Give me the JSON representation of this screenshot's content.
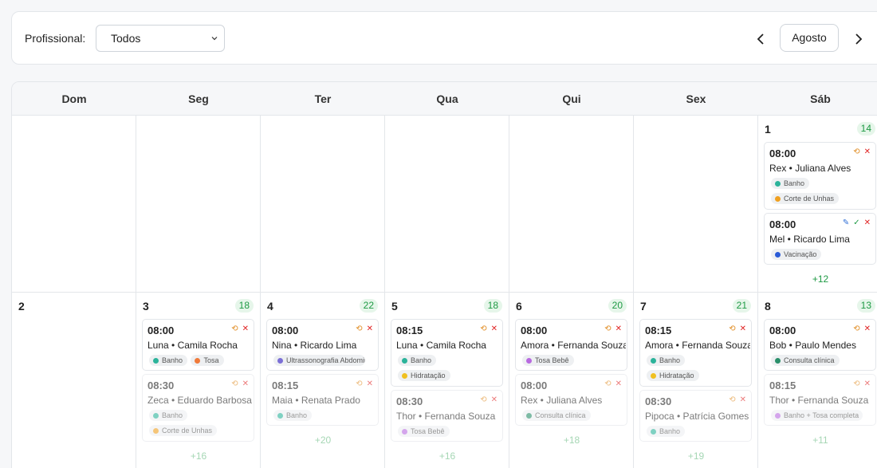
{
  "filter": {
    "label": "Profissional:",
    "selected": "Todos",
    "prev_icon": "chevron-left-icon",
    "next_icon": "chevron-right-icon",
    "month": "Agosto"
  },
  "weekdays": [
    "Dom",
    "Seg",
    "Ter",
    "Qua",
    "Qui",
    "Sex",
    "Sáb"
  ],
  "colors": {
    "banho": "#2bb39a",
    "tosa": "#f07a3a",
    "corte_unhas": "#f0a020",
    "vacinacao": "#2a5bd7",
    "ultrassonografia": "#7b6fd6",
    "hidratacao": "#f0c020",
    "tosa_bebe": "#b86ae0",
    "consulta": "#2a8f6a",
    "accent_green": "#1e9a44"
  },
  "days": {
    "d1": {
      "num": "1",
      "count": "14",
      "more": "+12",
      "appts": [
        {
          "time": "08:00",
          "who": "Rex • Juliana Alves",
          "tags": [
            "Banho",
            "Corte de Unhas"
          ]
        },
        {
          "time": "08:00",
          "who": "Mel • Ricardo Lima",
          "tags": [
            "Vacinação"
          ]
        }
      ]
    },
    "d2": {
      "num": "2"
    },
    "d3": {
      "num": "3",
      "count": "18",
      "more": "+16",
      "appts": [
        {
          "time": "08:00",
          "who": "Luna • Camila Rocha",
          "tags": [
            "Banho",
            "Tosa"
          ]
        },
        {
          "time": "08:30",
          "who": "Zeca • Eduardo Barbosa",
          "tags": [
            "Banho",
            "Corte de Unhas"
          ]
        }
      ]
    },
    "d4": {
      "num": "4",
      "count": "22",
      "more": "+20",
      "appts": [
        {
          "time": "08:00",
          "who": "Nina • Ricardo Lima",
          "tags": [
            "Ultrassonografia Abdominal"
          ]
        },
        {
          "time": "08:15",
          "who": "Maia • Renata Prado",
          "tags": [
            "Banho"
          ]
        }
      ]
    },
    "d5": {
      "num": "5",
      "count": "18",
      "more": "+16",
      "appts": [
        {
          "time": "08:15",
          "who": "Luna • Camila Rocha",
          "tags": [
            "Banho",
            "Hidratação"
          ]
        },
        {
          "time": "08:30",
          "who": "Thor • Fernanda Souza",
          "tags": [
            "Tosa Bebê"
          ]
        }
      ]
    },
    "d6": {
      "num": "6",
      "count": "20",
      "more": "+18",
      "appts": [
        {
          "time": "08:00",
          "who": "Amora • Fernanda Souza",
          "tags": [
            "Tosa Bebê"
          ]
        },
        {
          "time": "08:00",
          "who": "Rex • Juliana Alves",
          "tags": [
            "Consulta clínica"
          ]
        }
      ]
    },
    "d7": {
      "num": "7",
      "count": "21",
      "more": "+19",
      "appts": [
        {
          "time": "08:15",
          "who": "Amora • Fernanda Souza",
          "tags": [
            "Banho",
            "Hidratação"
          ]
        },
        {
          "time": "08:30",
          "who": "Pipoca • Patrícia Gomes",
          "tags": [
            "Banho"
          ]
        }
      ]
    },
    "d8": {
      "num": "8",
      "count": "13",
      "more": "+11",
      "appts": [
        {
          "time": "08:00",
          "who": "Bob • Paulo Mendes",
          "tags": [
            "Consulta clínica"
          ]
        },
        {
          "time": "08:15",
          "who": "Thor • Fernanda Souza",
          "tags": [
            "Banho + Tosa completa"
          ]
        }
      ]
    }
  }
}
